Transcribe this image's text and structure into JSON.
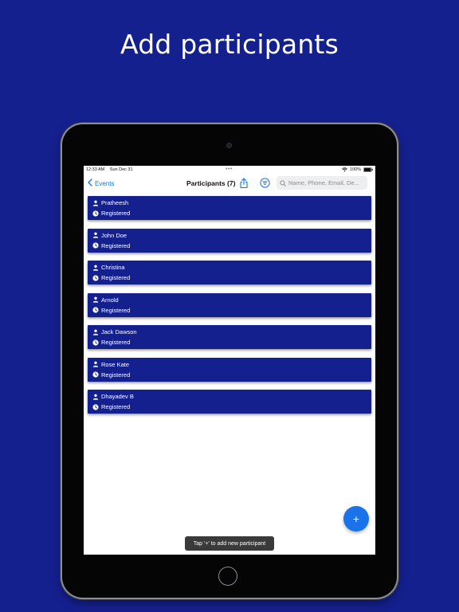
{
  "headline": "Add participants",
  "status_bar": {
    "time": "12:33 AM",
    "date": "Sun Dec 31",
    "dots": "•••",
    "battery": "100%"
  },
  "nav": {
    "back_label": "Events",
    "title": "Participants (7)"
  },
  "search": {
    "placeholder": "Name, Phone, Email, De...",
    "value": ""
  },
  "participants": [
    {
      "name": "Pratheesh",
      "status": "Registered"
    },
    {
      "name": "John Doe",
      "status": "Registered"
    },
    {
      "name": "Christina",
      "status": "Registered"
    },
    {
      "name": "Arnold",
      "status": "Registered"
    },
    {
      "name": "Jack Dawson",
      "status": "Registered"
    },
    {
      "name": "Rose Kate",
      "status": "Registered"
    },
    {
      "name": "Dhayadev B",
      "status": "Registered"
    }
  ],
  "fab_label": "+",
  "toast": "Tap '+' to add new participant",
  "icons": {
    "back": "chevron-left-icon",
    "share": "share-icon",
    "filter": "filter-icon",
    "search": "search-icon",
    "person": "person-icon",
    "status": "clock-icon",
    "wifi": "wifi-icon",
    "battery": "battery-icon"
  },
  "colors": {
    "background": "#15208f",
    "card": "#15208f",
    "accent": "#1a73e8",
    "toast": "#3a3a3a"
  }
}
